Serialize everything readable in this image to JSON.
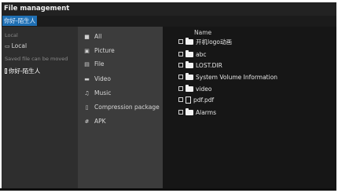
{
  "app": {
    "title": "File management",
    "title_tag": "你好-陌生人"
  },
  "devices": {
    "local_header": "Local",
    "local_item": "Local",
    "saved_header": "Saved file can be moved",
    "saved_item": "你好-陌生人"
  },
  "categories": [
    "All",
    "Picture",
    "File",
    "Video",
    "Music",
    "Compression package",
    "APK"
  ],
  "category_icons": [
    "all-icon",
    "picture-icon",
    "file-icon",
    "video-icon",
    "music-icon",
    "compression-package-icon",
    "apk-icon"
  ],
  "file_list": {
    "column_name": "Name",
    "items": [
      {
        "name": "开机logo动画",
        "type": "folder"
      },
      {
        "name": "abc",
        "type": "folder"
      },
      {
        "name": "LOST.DIR",
        "type": "folder"
      },
      {
        "name": "System Volume Information",
        "type": "folder"
      },
      {
        "name": "video",
        "type": "folder"
      },
      {
        "name": "pdf.pdf",
        "type": "file"
      },
      {
        "name": "Alarms",
        "type": "folder"
      }
    ]
  },
  "colors": {
    "accent": "#1f6fb3",
    "background": "#1b1b1b",
    "sidebar": "#2e2e2e",
    "category_panel": "#3c3c3c",
    "file_panel": "#161616"
  }
}
